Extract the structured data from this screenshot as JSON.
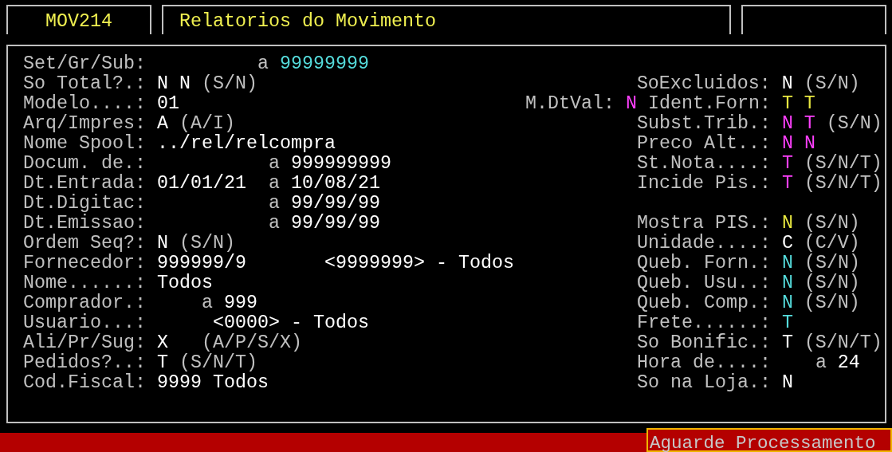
{
  "header": {
    "program_code": "MOV214",
    "title": "Relatorios do Movimento"
  },
  "lines": [
    {
      "fields": [
        {
          "label": "Set/Gr/Sub:",
          "values": [
            {
              "text": "a",
              "color": "#c0c0c0"
            },
            {
              "text": "99999999",
              "color": "#55dcdc"
            }
          ]
        }
      ]
    },
    {
      "fields": [
        {
          "label": "So Total?.:",
          "values": [
            {
              "text": "N",
              "color": "#ffffff"
            },
            {
              "text": "N",
              "color": "#ffffff"
            },
            {
              "text": "(S/N)",
              "color": "#c0c0c0"
            }
          ]
        },
        {
          "label": "SoExcluidos:",
          "values": [
            {
              "text": "N",
              "color": "#ffffff"
            },
            {
              "text": "(S/N)",
              "color": "#c0c0c0"
            }
          ]
        }
      ]
    },
    {
      "fields": [
        {
          "label": "Modelo....:",
          "values": [
            {
              "text": "01",
              "color": "#ffffff"
            }
          ]
        },
        {
          "label": "M.DtVal:",
          "values": [
            {
              "text": "N",
              "color": "#ff40ff"
            }
          ]
        },
        {
          "label": "Ident.Forn:",
          "values": [
            {
              "text": "T",
              "color": "#e8e840"
            },
            {
              "text": "T",
              "color": "#e8e840"
            }
          ]
        }
      ]
    },
    {
      "fields": [
        {
          "label": "Arq/Impres:",
          "values": [
            {
              "text": "A",
              "color": "#ffffff"
            },
            {
              "text": "(A/I)",
              "color": "#c0c0c0"
            }
          ]
        },
        {
          "label": "Subst.Trib.:",
          "values": [
            {
              "text": "N",
              "color": "#ff40ff"
            },
            {
              "text": "T",
              "color": "#ff40ff"
            },
            {
              "text": "(S/N)",
              "color": "#c0c0c0"
            }
          ]
        }
      ]
    },
    {
      "fields": [
        {
          "label": "Nome Spool:",
          "values": [
            {
              "text": "../rel/relcompra",
              "color": "#ffffff"
            }
          ]
        },
        {
          "label": "Preco Alt..:",
          "values": [
            {
              "text": "N",
              "color": "#ff40ff"
            },
            {
              "text": "N",
              "color": "#ff40ff"
            }
          ]
        }
      ]
    },
    {
      "fields": [
        {
          "label": "Docum. de.:",
          "values": [
            {
              "text": "a",
              "color": "#c0c0c0"
            },
            {
              "text": "999999999",
              "color": "#ffffff"
            }
          ]
        },
        {
          "label": "St.Nota....:",
          "values": [
            {
              "text": "T",
              "color": "#ff40ff"
            },
            {
              "text": "(S/N/T)",
              "color": "#c0c0c0"
            }
          ]
        }
      ]
    },
    {
      "fields": [
        {
          "label": "Dt.Entrada:",
          "values": [
            {
              "text": "01/01/21",
              "color": "#ffffff"
            },
            {
              "text": "a",
              "color": "#c0c0c0"
            },
            {
              "text": "10/08/21",
              "color": "#ffffff"
            }
          ]
        },
        {
          "label": "Incide Pis.:",
          "values": [
            {
              "text": "T",
              "color": "#ff40ff"
            },
            {
              "text": "(S/N/T)",
              "color": "#c0c0c0"
            }
          ]
        }
      ]
    },
    {
      "fields": [
        {
          "label": "Dt.Digitac:",
          "values": [
            {
              "text": "a",
              "color": "#c0c0c0"
            },
            {
              "text": "99/99/99",
              "color": "#ffffff"
            }
          ]
        }
      ]
    },
    {
      "fields": [
        {
          "label": "Dt.Emissao:",
          "values": [
            {
              "text": "a",
              "color": "#c0c0c0"
            },
            {
              "text": "99/99/99",
              "color": "#ffffff"
            }
          ]
        },
        {
          "label": "Mostra PIS.:",
          "values": [
            {
              "text": "N",
              "color": "#e8e840"
            },
            {
              "text": "(S/N)",
              "color": "#c0c0c0"
            }
          ]
        }
      ]
    },
    {
      "fields": [
        {
          "label": "Ordem Seq?:",
          "values": [
            {
              "text": "N",
              "color": "#ffffff"
            },
            {
              "text": "(S/N)",
              "color": "#c0c0c0"
            }
          ]
        },
        {
          "label": "Unidade....:",
          "values": [
            {
              "text": "C",
              "color": "#ffffff"
            },
            {
              "text": "(C/V)",
              "color": "#c0c0c0"
            }
          ]
        }
      ]
    },
    {
      "fields": [
        {
          "label": "Fornecedor:",
          "values": [
            {
              "text": "999999/9",
              "color": "#ffffff"
            },
            {
              "text": "<9999999> - Todos",
              "color": "#ffffff"
            }
          ]
        },
        {
          "label": "Queb. Forn.:",
          "values": [
            {
              "text": "N",
              "color": "#55dcdc"
            },
            {
              "text": "(S/N)",
              "color": "#c0c0c0"
            }
          ]
        }
      ]
    },
    {
      "fields": [
        {
          "label": "Nome......:",
          "values": [
            {
              "text": "Todos",
              "color": "#ffffff"
            }
          ]
        },
        {
          "label": "Queb. Usu..:",
          "values": [
            {
              "text": "N",
              "color": "#55dcdc"
            },
            {
              "text": "(S/N)",
              "color": "#c0c0c0"
            }
          ]
        }
      ]
    },
    {
      "fields": [
        {
          "label": "Comprador.:",
          "values": [
            {
              "text": "a",
              "color": "#c0c0c0"
            },
            {
              "text": "999",
              "color": "#ffffff"
            }
          ]
        },
        {
          "label": "Queb. Comp.:",
          "values": [
            {
              "text": "N",
              "color": "#55dcdc"
            },
            {
              "text": "(S/N)",
              "color": "#c0c0c0"
            }
          ]
        }
      ]
    },
    {
      "fields": [
        {
          "label": "Usuario...:",
          "values": [
            {
              "text": "<0000> - Todos",
              "color": "#ffffff"
            }
          ]
        },
        {
          "label": "Frete......:",
          "values": [
            {
              "text": "T",
              "color": "#55dcdc"
            }
          ]
        }
      ]
    },
    {
      "fields": [
        {
          "label": "Ali/Pr/Sug:",
          "values": [
            {
              "text": "X",
              "color": "#ffffff"
            },
            {
              "text": "(A/P/S/X)",
              "color": "#c0c0c0"
            }
          ]
        },
        {
          "label": "So Bonific.:",
          "values": [
            {
              "text": "T",
              "color": "#ffffff"
            },
            {
              "text": "(S/N/T)",
              "color": "#c0c0c0"
            }
          ]
        }
      ]
    },
    {
      "fields": [
        {
          "label": "Pedidos?..:",
          "values": [
            {
              "text": "T",
              "color": "#ffffff"
            },
            {
              "text": "(S/N/T)",
              "color": "#c0c0c0"
            }
          ]
        },
        {
          "label": "Hora de....:",
          "values": [
            {
              "text": "a",
              "color": "#c0c0c0"
            },
            {
              "text": "24",
              "color": "#ffffff"
            }
          ]
        }
      ]
    },
    {
      "fields": [
        {
          "label": "Cod.Fiscal:",
          "values": [
            {
              "text": "9999 Todos",
              "color": "#ffffff"
            }
          ]
        },
        {
          "label": "So na Loja.:",
          "values": [
            {
              "text": "N",
              "color": "#ffffff"
            }
          ]
        }
      ]
    }
  ],
  "status_bar": {
    "message": "Aguarde Processamento"
  }
}
